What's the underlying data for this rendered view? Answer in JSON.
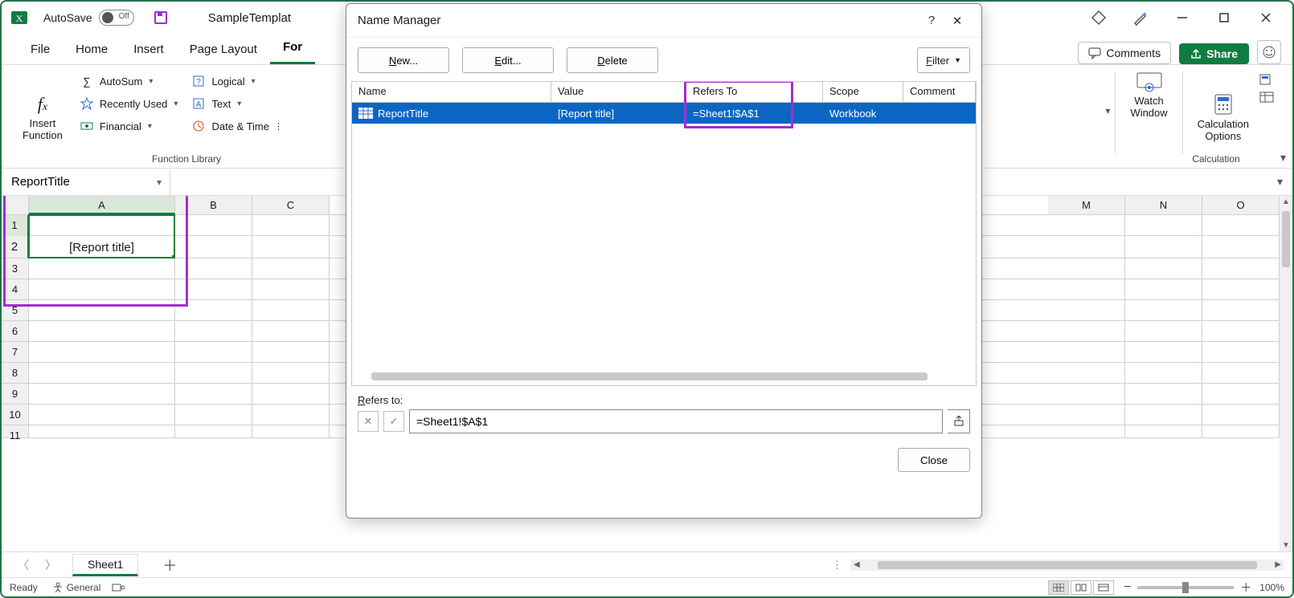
{
  "app": {
    "autosave_label": "AutoSave",
    "autosave_state": "Off",
    "doc_name": "SampleTemplat"
  },
  "tabs": {
    "file": "File",
    "home": "Home",
    "insert": "Insert",
    "pagelayout": "Page Layout",
    "formulas": "For",
    "active": "formulas",
    "comments": "Comments",
    "share": "Share"
  },
  "ribbon": {
    "insert_fn": "Insert\nFunction",
    "autosum": "AutoSum",
    "recent": "Recently Used",
    "financial": "Financial",
    "logical": "Logical",
    "text": "Text",
    "datetime": "Date & Time",
    "group_lib": "Function Library",
    "watch": "Watch\nWindow",
    "calc_opts": "Calculation\nOptions",
    "group_calc": "Calculation"
  },
  "namebox": "ReportTitle",
  "sheet": {
    "cols": [
      "A",
      "B",
      "C",
      "M",
      "N",
      "O"
    ],
    "a1_value": "[Report title]",
    "tab": "Sheet1"
  },
  "status": {
    "ready": "Ready",
    "general": "General",
    "zoom": "100%"
  },
  "dialog": {
    "title": "Name Manager",
    "new": "New...",
    "edit": "Edit...",
    "delete": "Delete",
    "filter": "Filter",
    "hdr_name": "Name",
    "hdr_value": "Value",
    "hdr_refers": "Refers To",
    "hdr_scope": "Scope",
    "hdr_comment": "Comment",
    "row": {
      "name": "ReportTitle",
      "value": "[Report title]",
      "refers": "=Sheet1!$A$1",
      "scope": "Workbook",
      "comment": ""
    },
    "refers_label": "Refers to:",
    "refers_value": "=Sheet1!$A$1",
    "close": "Close"
  }
}
